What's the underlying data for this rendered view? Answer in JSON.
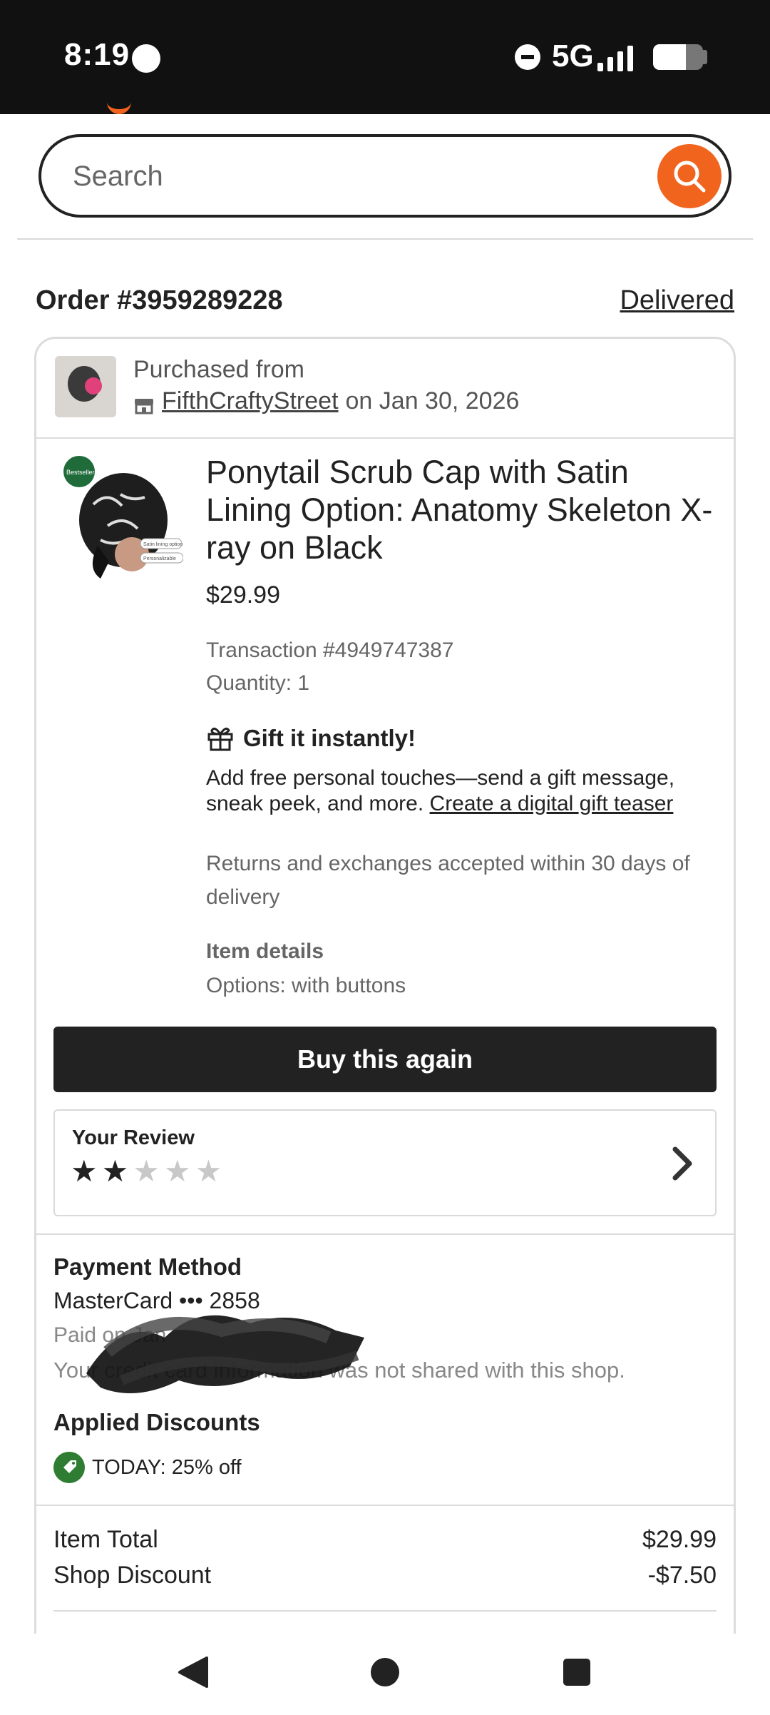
{
  "status_bar": {
    "time": "8:19",
    "network": "5G",
    "battery_level": 0.65,
    "signal_bars": 4
  },
  "search": {
    "placeholder": "Search",
    "value": "",
    "accent_color": "#f1641e"
  },
  "order": {
    "number_label": "Order #3959289228",
    "status": "Delivered"
  },
  "shop": {
    "purchased_from": "Purchased from",
    "name": "FifthCraftyStreet",
    "date_text": "on Jan 30, 2026"
  },
  "product": {
    "title": "Ponytail Scrub Cap with Satin Lining Option: Anatomy Skeleton X-ray on Black",
    "price": "$29.99",
    "transaction": "Transaction #4949747387",
    "quantity": "Quantity: 1",
    "thumb_badge": "Bestseller",
    "thumb_tags": [
      "Satin lining option",
      "Personalizable"
    ]
  },
  "gift": {
    "heading": "Gift it instantly!",
    "text": "Add free personal touches—send a gift message, sneak peek, and more.",
    "link": "Create a digital gift teaser"
  },
  "returns": {
    "text": "Returns and exchanges accepted within 30 days of delivery"
  },
  "item_details": {
    "label": "Item details",
    "options": "Options: with buttons"
  },
  "actions": {
    "buy_again": "Buy this again"
  },
  "review": {
    "label": "Your Review",
    "rating": 2,
    "max_rating": 5
  },
  "payment": {
    "heading": "Payment Method",
    "card": "MasterCard ••• 2858",
    "paid_on": "Paid on Jan",
    "note": "Your credit card information was not shared with this shop."
  },
  "discounts": {
    "heading": "Applied Discounts",
    "items": [
      "TODAY: 25% off"
    ],
    "tag_color": "#2e7d32"
  },
  "totals": {
    "item_total_label": "Item Total",
    "item_total_value": "$29.99",
    "shop_discount_label": "Shop Discount",
    "shop_discount_value": "-$7.50"
  }
}
